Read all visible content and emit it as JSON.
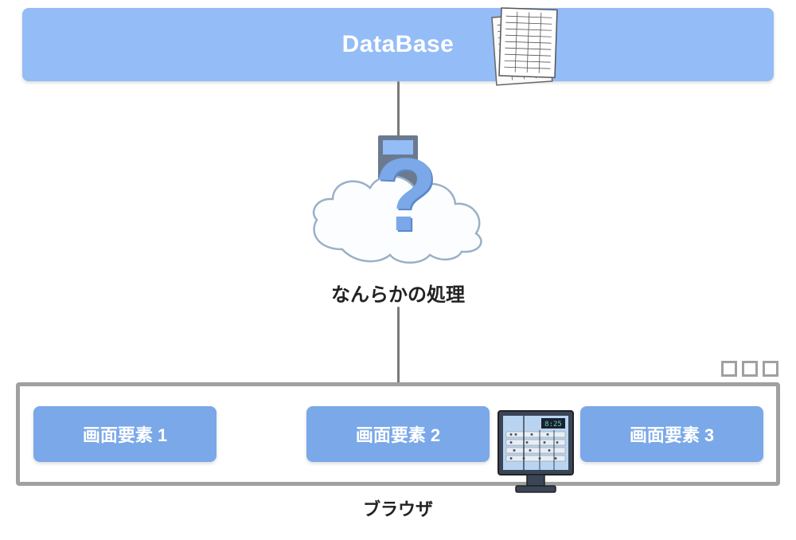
{
  "database": {
    "title": "DataBase"
  },
  "middle": {
    "label": "なんらかの処理"
  },
  "elements": {
    "item1": "画面要素 1",
    "item2": "画面要素 2",
    "item3": "画面要素 3"
  },
  "browser": {
    "label": "ブラウザ"
  },
  "monitor": {
    "time": "8:25"
  },
  "colors": {
    "database_bg": "#94bcf7",
    "element_bg": "#7aa8e8",
    "frame": "#a0a0a0"
  }
}
